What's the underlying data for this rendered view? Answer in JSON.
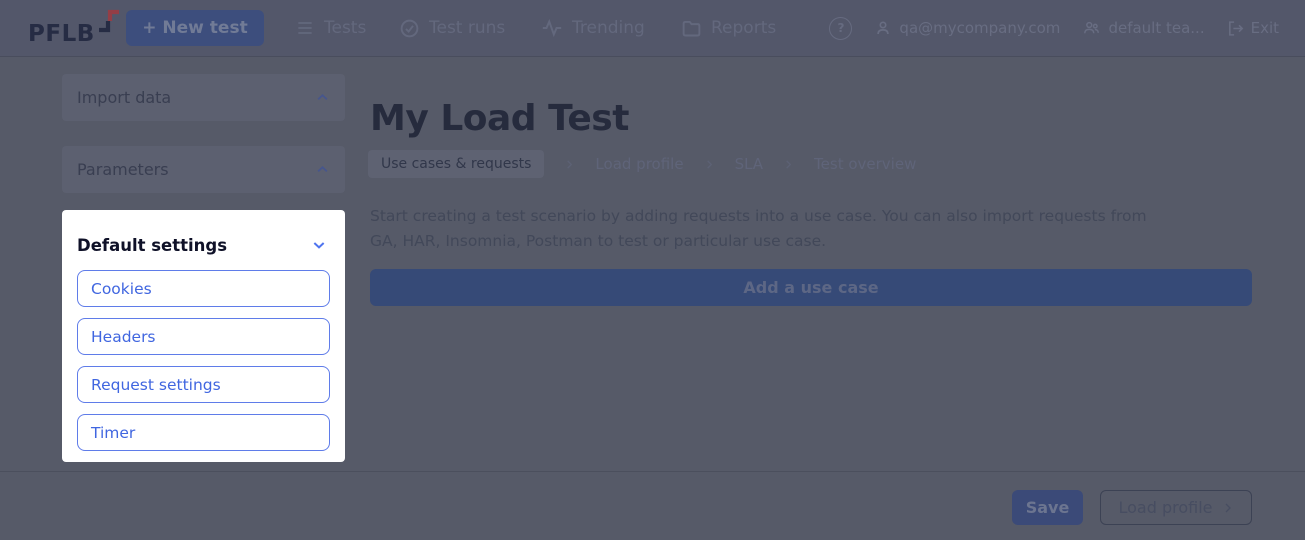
{
  "topbar": {
    "logo_text": "PFLB",
    "new_test_label": "+ New test",
    "nav": [
      {
        "label": "Tests",
        "icon": "list-icon"
      },
      {
        "label": "Test runs",
        "icon": "check-circle-icon"
      },
      {
        "label": "Trending",
        "icon": "activity-icon"
      },
      {
        "label": "Reports",
        "icon": "folder-icon"
      }
    ],
    "help_glyph": "?",
    "user_email": "qa@mycompany.com",
    "team_name": "default tea...",
    "exit_label": "Exit"
  },
  "sidebar": {
    "sections": [
      {
        "label": "Import data",
        "chevron": "up"
      },
      {
        "label": "Parameters",
        "chevron": "up"
      }
    ],
    "default_settings": {
      "label": "Default settings",
      "chevron": "down",
      "items": [
        "Cookies",
        "Headers",
        "Request settings",
        "Timer"
      ]
    }
  },
  "main": {
    "title": "My Load Test",
    "steps": [
      {
        "label": "Use cases & requests",
        "active": true
      },
      {
        "label": "Load profile",
        "active": false
      },
      {
        "label": "SLA",
        "active": false
      },
      {
        "label": "Test overview",
        "active": false
      }
    ],
    "description_line1": "Start creating a test scenario by adding requests into a use case. You can also import requests from",
    "description_line2": "GA, HAR, Insomnia, Postman to test or particular use case.",
    "add_use_case_label": "Add a use case"
  },
  "footer": {
    "save_label": "Save",
    "load_profile_label": "Load profile"
  },
  "colors": {
    "accent_blue": "#4066e0",
    "panel_border_blue": "#5f7ce9",
    "panel_bg": "#ffffff",
    "dim_background": "#565a68",
    "brand_navy": "#262c44",
    "brand_red": "#943e46"
  }
}
